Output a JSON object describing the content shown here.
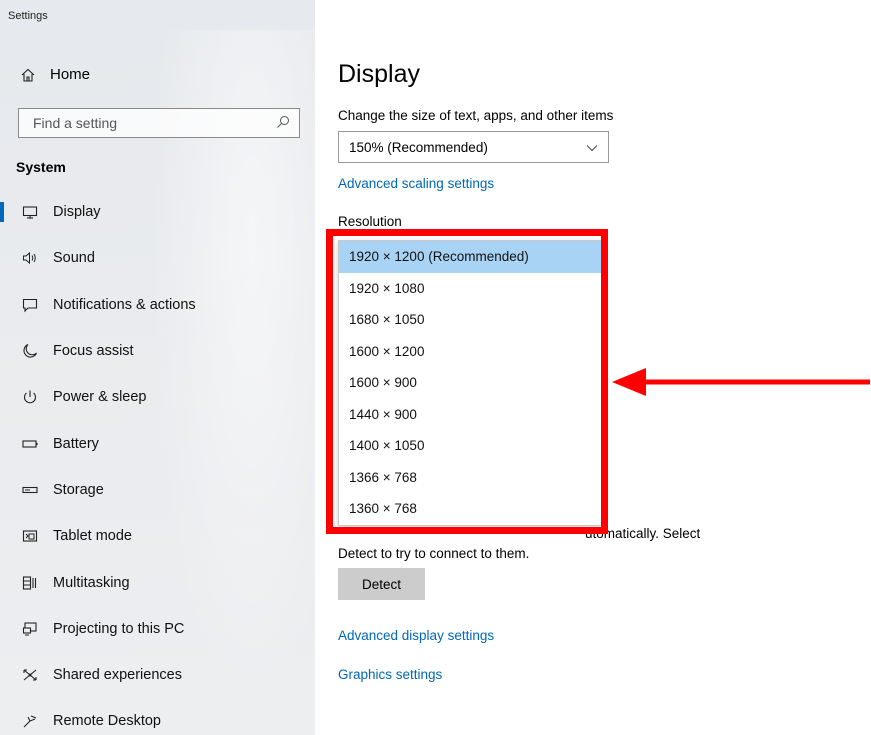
{
  "window": {
    "title": "Settings"
  },
  "sidebar": {
    "home_label": "Home",
    "search_placeholder": "Find a setting",
    "section_title": "System",
    "items": [
      {
        "label": "Display",
        "icon": "monitor-icon"
      },
      {
        "label": "Sound",
        "icon": "speaker-icon"
      },
      {
        "label": "Notifications & actions",
        "icon": "notification-icon"
      },
      {
        "label": "Focus assist",
        "icon": "moon-icon"
      },
      {
        "label": "Power & sleep",
        "icon": "power-icon"
      },
      {
        "label": "Battery",
        "icon": "battery-icon"
      },
      {
        "label": "Storage",
        "icon": "storage-icon"
      },
      {
        "label": "Tablet mode",
        "icon": "tablet-mode-icon"
      },
      {
        "label": "Multitasking",
        "icon": "multitasking-icon"
      },
      {
        "label": "Projecting to this PC",
        "icon": "projecting-icon"
      },
      {
        "label": "Shared experiences",
        "icon": "shared-experiences-icon"
      },
      {
        "label": "Remote Desktop",
        "icon": "remote-desktop-icon"
      }
    ],
    "active_item": "Display"
  },
  "main": {
    "title": "Display",
    "scale_label": "Change the size of text, apps, and other items",
    "scale_value": "150% (Recommended)",
    "advanced_scaling_link": "Advanced scaling settings",
    "resolution_label": "Resolution",
    "resolution_options": [
      "1920 × 1200 (Recommended)",
      "1920 × 1080",
      "1680 × 1050",
      "1600 × 1200",
      "1600 × 900",
      "1440 × 900",
      "1400 × 1050",
      "1366 × 768",
      "1360 × 768"
    ],
    "resolution_selected": "1920 × 1200 (Recommended)",
    "detect_text_partial": "utomatically. Select",
    "detect_text_line2": "Detect to try to connect to them.",
    "detect_button": "Detect",
    "advanced_display_link": "Advanced display settings",
    "graphics_link": "Graphics settings"
  },
  "colors": {
    "accent": "#0067b8",
    "annotation": "#ff0000",
    "selected_option": "#a9d3f5"
  }
}
